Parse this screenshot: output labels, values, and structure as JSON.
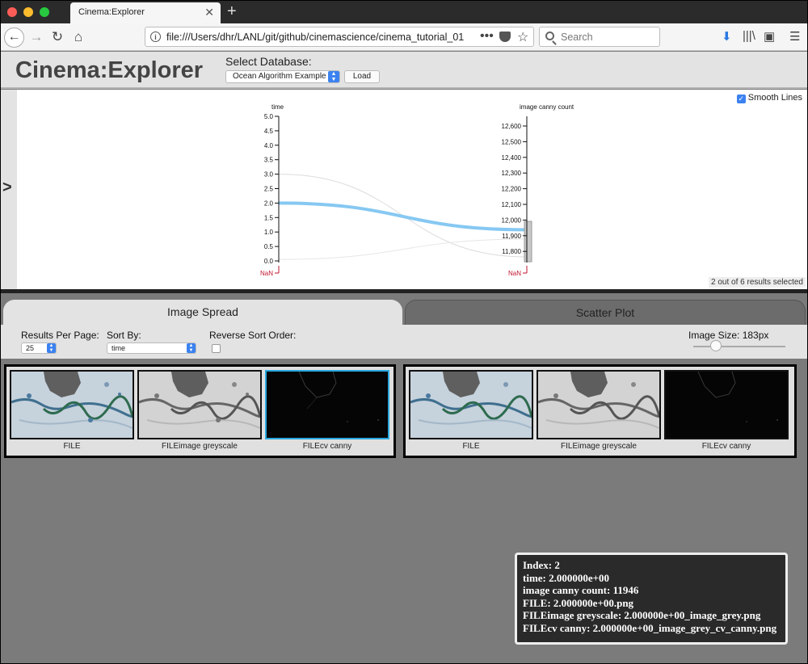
{
  "browser": {
    "tab_title": "Cinema:Explorer",
    "url": "file:///Users/dhr/LANL/git/github/cinemascience/cinema_tutorial_01",
    "search_placeholder": "Search",
    "url_dots": "•••"
  },
  "app": {
    "title": "Cinema:Explorer",
    "select_db_label": "Select Database:",
    "db_selected": "Ocean Algorithm Example",
    "load_label": "Load"
  },
  "pcoord": {
    "smooth_lines_label": "Smooth Lines",
    "smooth_lines_checked": true,
    "results_selected": "2 out of 6 results selected",
    "toggle_label": ">",
    "axes": [
      {
        "label": "time",
        "ticks": [
          "5.0",
          "4.5",
          "4.0",
          "3.5",
          "3.0",
          "2.5",
          "2.0",
          "1.5",
          "1.0",
          "0.5",
          "0.0"
        ],
        "nan_label": "NaN"
      },
      {
        "label": "image canny count",
        "ticks": [
          "12,600",
          "12,500",
          "12,400",
          "12,300",
          "12,200",
          "12,100",
          "12,000",
          "11,900",
          "11,800"
        ],
        "nan_label": "NaN"
      }
    ],
    "highlight_color": "#86c8f2",
    "brush_color": "#c8c8c8",
    "nan_color": "#c0152f"
  },
  "views": {
    "tabs": [
      "Image Spread",
      "Scatter Plot"
    ],
    "active_tab": "Image Spread",
    "results_per_page_label": "Results Per Page:",
    "results_per_page_value": "25",
    "sort_by_label": "Sort By:",
    "sort_by_value": "time",
    "reverse_sort_label": "Reverse Sort Order:",
    "image_size_label": "Image Size: 183px"
  },
  "results": [
    {
      "thumbnails": [
        {
          "label": "FILE",
          "image": "ocean-color-thumbnail"
        },
        {
          "label": "FILEimage greyscale",
          "image": "ocean-greyscale-thumbnail"
        },
        {
          "label": "FILEcv canny",
          "image": "ocean-canny-thumbnail"
        }
      ]
    },
    {
      "thumbnails": [
        {
          "label": "FILE",
          "image": "ocean-color-thumbnail"
        },
        {
          "label": "FILEimage greyscale",
          "image": "ocean-greyscale-thumbnail"
        },
        {
          "label": "FILEcv canny",
          "image": "ocean-canny-thumbnail"
        }
      ]
    }
  ],
  "tooltip": {
    "lines": [
      "Index: 2",
      "time: 2.000000e+00",
      "image canny count: 11946",
      "FILE: 2.000000e+00.png",
      "FILEimage greyscale: 2.000000e+00_image_grey.png",
      "FILEcv canny: 2.000000e+00_image_grey_cv_canny.png"
    ]
  }
}
